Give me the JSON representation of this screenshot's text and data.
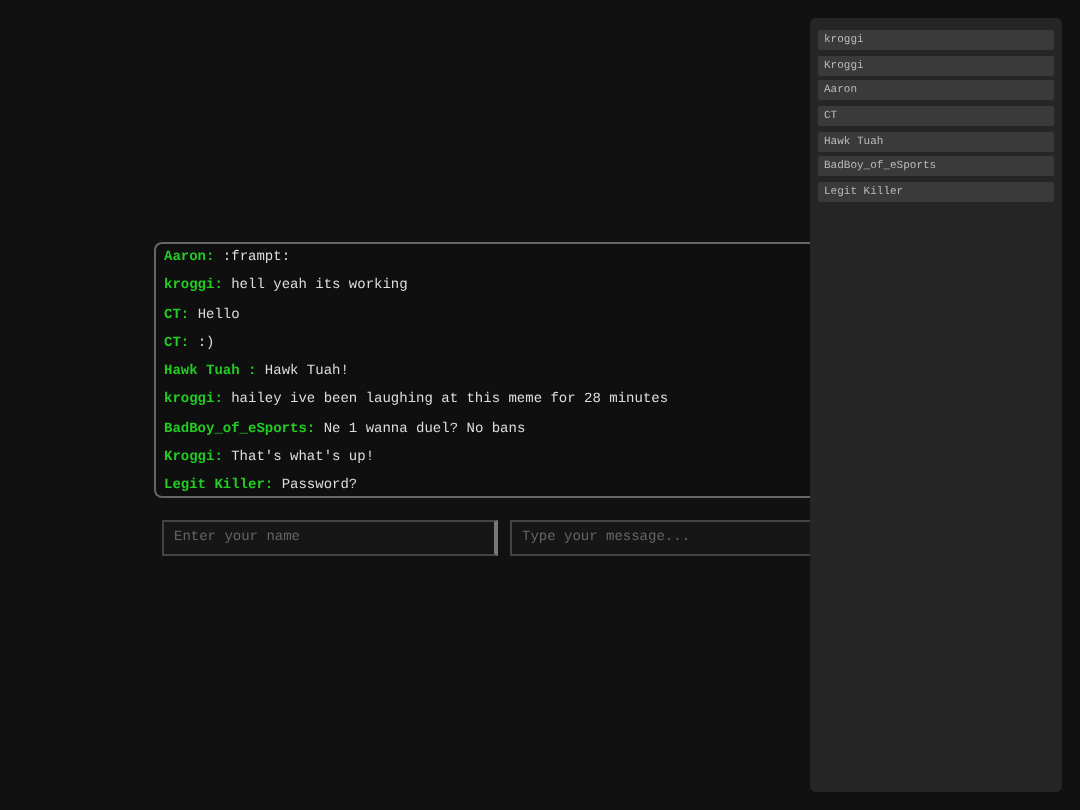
{
  "chat": {
    "messages": [
      {
        "user": "Aaron:",
        "text": ":frampt:"
      },
      {
        "user": "kroggi:",
        "text": "hell yeah its working"
      },
      {
        "user": "CT:",
        "text": "Hello"
      },
      {
        "user": "CT:",
        "text": ":)"
      },
      {
        "user": "Hawk Tuah :",
        "text": "Hawk Tuah!"
      },
      {
        "user": "kroggi:",
        "text": "hailey ive been laughing at this meme for 28 minutes"
      },
      {
        "user": "BadBoy_of_eSports:",
        "text": "Ne 1 wanna duel? No bans"
      },
      {
        "user": "Kroggi:",
        "text": "That's what's up!"
      },
      {
        "user": "Legit Killer:",
        "text": "Password?"
      }
    ]
  },
  "name_field": {
    "placeholder": "Enter your name"
  },
  "message_field": {
    "placeholder": "Type your message..."
  },
  "sidebar": {
    "users": [
      "kroggi",
      "Kroggi",
      "Aaron",
      "CT",
      "Hawk Tuah",
      "BadBoy_of_eSports",
      "Legit Killer"
    ]
  }
}
